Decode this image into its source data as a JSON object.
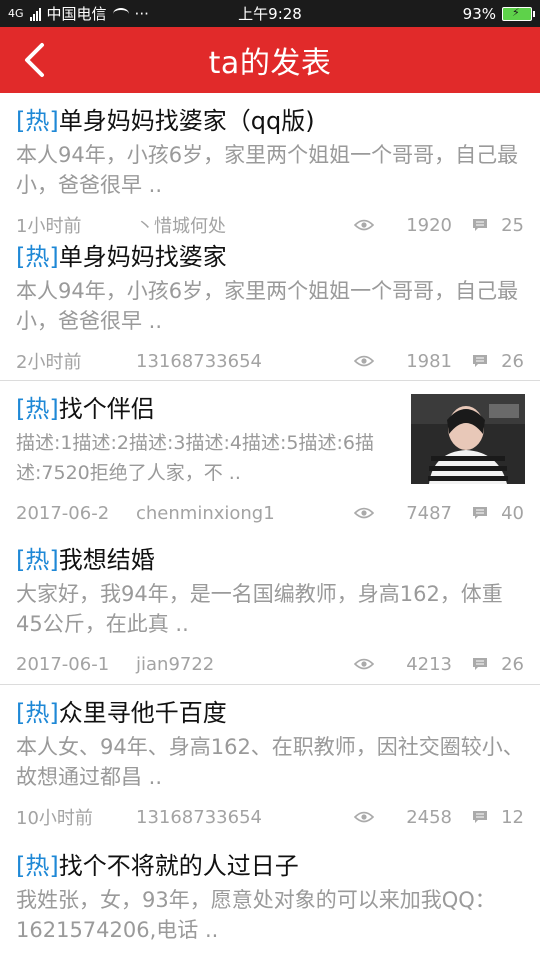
{
  "status_bar": {
    "carrier": "中国电信",
    "time": "上午9:28",
    "battery": "93%",
    "signal_label": "4G",
    "more": "···"
  },
  "header": {
    "title": "ta的发表"
  },
  "posts": [
    {
      "hot_tag": "[热]",
      "title": "单身妈妈找婆家（qq版)",
      "summary": "本人94年，小孩6岁，家里两个姐姐一个哥哥，自己最小，爸爸很早 ..",
      "time": "1小时前",
      "author": "丶惜城何处",
      "views": "1920",
      "comments": "25"
    },
    {
      "hot_tag": "[热]",
      "title": "单身妈妈找婆家",
      "summary": "本人94年，小孩6岁，家里两个姐姐一个哥哥，自己最小，爸爸很早 ..",
      "time": "2小时前",
      "author": "13168733654",
      "views": "1981",
      "comments": "26"
    },
    {
      "hot_tag": "[热]",
      "title": "找个伴侣",
      "summary": "描述:1描述:2描述:3描述:4描述:5描述:6描述:7520拒绝了人家，不 ..",
      "time": "2017-06-2",
      "author": "chenminxiong1",
      "views": "7487",
      "comments": "40"
    },
    {
      "hot_tag": "[热]",
      "title": "我想结婚",
      "summary": "大家好，我94年，是一名国编教师，身高162，体重45公斤，在此真 ..",
      "time": "2017-06-1",
      "author": "jian9722",
      "views": "4213",
      "comments": "26"
    },
    {
      "hot_tag": "[热]",
      "title": "众里寻他千百度",
      "summary": "本人女、94年、身高162、在职教师，因社交圈较小、故想通过都昌 ..",
      "time": "10小时前",
      "author": "13168733654",
      "views": "2458",
      "comments": "12"
    },
    {
      "hot_tag": "[热]",
      "title": "找个不将就的人过日子",
      "summary": "我姓张，女，93年，愿意处对象的可以来加我QQ：1621574206,电话 .."
    }
  ]
}
